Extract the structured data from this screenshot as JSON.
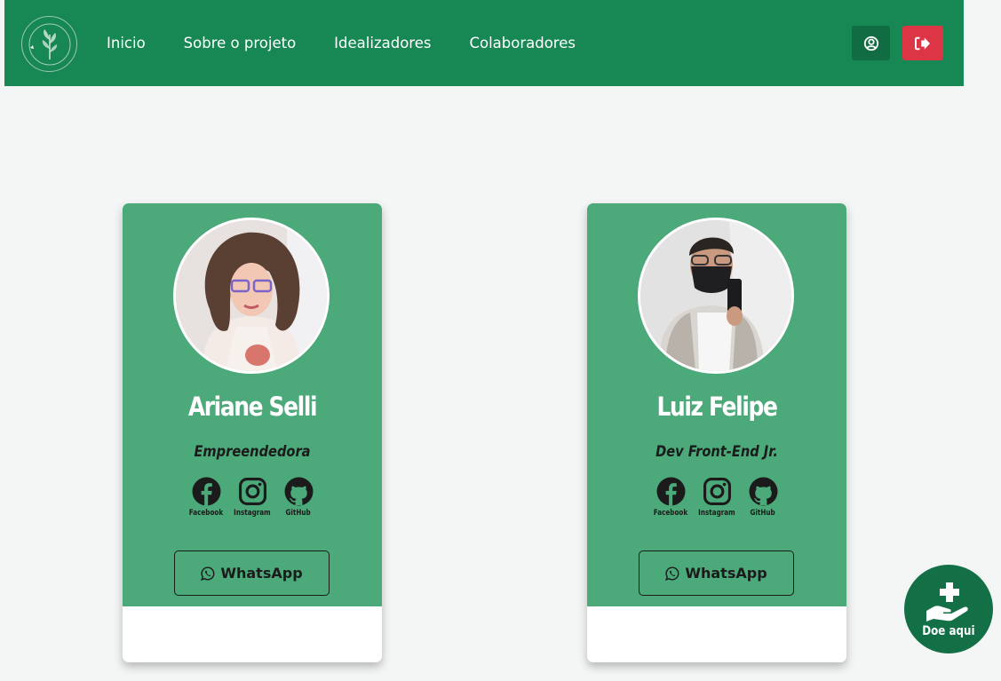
{
  "nav": {
    "links": [
      "Inicio",
      "Sobre o projeto",
      "Idealizadores",
      "Colaboradores"
    ]
  },
  "cards": [
    {
      "name": "Ariane Selli",
      "role": "Empreendedora",
      "socials": [
        "Facebook",
        "Instagram",
        "GitHub"
      ],
      "whatsapp_label": "WhatsApp"
    },
    {
      "name": "Luiz Felipe",
      "role": "Dev Front-End Jr.",
      "socials": [
        "Facebook",
        "Instagram",
        "GitHub"
      ],
      "whatsapp_label": "WhatsApp"
    }
  ],
  "donate": {
    "label": "Doe aqui"
  },
  "colors": {
    "navbar": "#178754",
    "card": "#4ba97a",
    "logout": "#dc3545",
    "donate": "#137046",
    "background": "#f4f5f5"
  }
}
